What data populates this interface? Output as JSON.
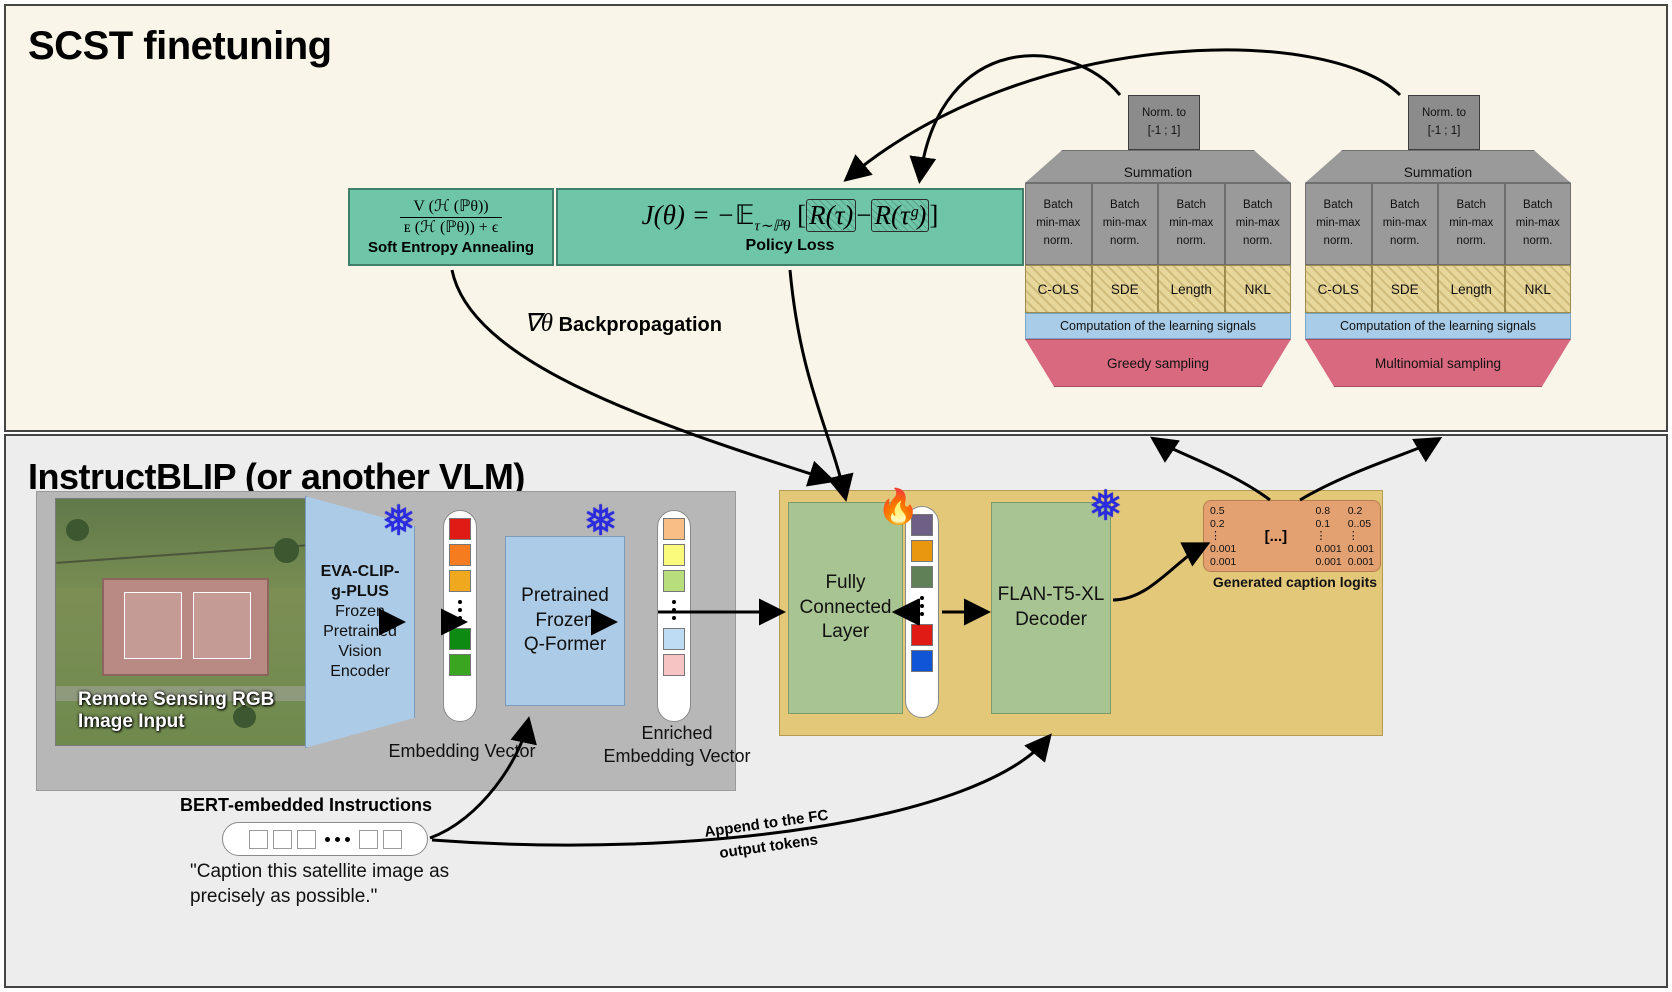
{
  "panels": {
    "scst_title": "SCST finetuning",
    "vlm_title": "InstructBLIP (or another VLM)"
  },
  "formulas": {
    "sea_numerator": "V (ℋ (ℙθ))",
    "sea_denominator": "ᴇ (ℋ (ℙθ)) + ϵ",
    "sea_label": "Soft Entropy Annealing",
    "policy_loss_label": "Policy Loss",
    "policy_eq_lhs": "J(θ) = −",
    "policy_eq_exp": "𝔼",
    "policy_eq_sub": "τ∼ℙθ",
    "policy_eq_bracket_open": "[",
    "policy_eq_term1": "R(τ)",
    "policy_eq_minus": "−",
    "policy_eq_term2": "R(τᵍ)",
    "policy_eq_bracket_close": "]",
    "backprop_label": "Backpropagation",
    "backprop_symbol": "∇θ"
  },
  "reward_columns": [
    {
      "id": "greedy",
      "norm_line1": "Norm. to",
      "norm_line2": "[-1 ; 1]",
      "summation": "Summation",
      "norm_cells": [
        {
          "l1": "Batch",
          "l2": "min-max",
          "l3": "norm."
        },
        {
          "l1": "Batch",
          "l2": "min-max",
          "l3": "norm."
        },
        {
          "l1": "Batch",
          "l2": "min-max",
          "l3": "norm."
        },
        {
          "l1": "Batch",
          "l2": "min-max",
          "l3": "norm."
        }
      ],
      "rewards": [
        "C-OLS",
        "SDE",
        "Length",
        "NKL"
      ],
      "signals": "Computation of the learning signals",
      "sampling": "Greedy sampling"
    },
    {
      "id": "multinomial",
      "norm_line1": "Norm. to",
      "norm_line2": "[-1 ; 1]",
      "summation": "Summation",
      "norm_cells": [
        {
          "l1": "Batch",
          "l2": "min-max",
          "l3": "norm."
        },
        {
          "l1": "Batch",
          "l2": "min-max",
          "l3": "norm."
        },
        {
          "l1": "Batch",
          "l2": "min-max",
          "l3": "norm."
        },
        {
          "l1": "Batch",
          "l2": "min-max",
          "l3": "norm."
        }
      ],
      "rewards": [
        "C-OLS",
        "SDE",
        "Length",
        "NKL"
      ],
      "signals": "Computation of the learning signals",
      "sampling": "Multinomial sampling"
    }
  ],
  "vlm": {
    "image_caption": "Remote Sensing RGB Image Input",
    "vision_encoder": {
      "bold_line1": "EVA-CLIP-",
      "bold_line2": "g-PLUS",
      "line3": "Frozen",
      "line4": "Pretrained",
      "line5": "Vision",
      "line6": "Encoder"
    },
    "qformer": {
      "line1": "Pretrained",
      "line2": "Frozen",
      "line3": "Q-Former"
    },
    "embedding_label": "Embedding Vector",
    "enriched_label": "Enriched Embedding Vector",
    "fc_layer": {
      "line1": "Fully",
      "line2": "Connected",
      "line3": "Layer"
    },
    "decoder": {
      "line1": "FLAN-T5-XL",
      "line2": "Decoder"
    },
    "vectors": {
      "embedding_colors": [
        "#e01b16",
        "#f57d20",
        "#f0a81e",
        "#0c8a12",
        "#3aa520"
      ],
      "enriched_colors": [
        "#f9bd86",
        "#fafa7d",
        "#b7dd7d",
        "#bfdcf5",
        "#f7c4c4"
      ],
      "fc_colors": [
        "#6d5f86",
        "#e8970e",
        "#5e8158",
        "#e01b16",
        "#0f55d6"
      ]
    },
    "icons": {
      "snowflake": "❅",
      "flame": "🔥"
    }
  },
  "logits": {
    "label": "Generated caption logits",
    "col1": [
      "0.5",
      "0.2",
      "⋮",
      "0.001",
      "0.001"
    ],
    "ellipsis": "[...]",
    "col2": [
      "0.8",
      "0.1",
      "⋮",
      "0.001",
      "0.001"
    ],
    "col3": [
      "0.2",
      "0..05",
      "⋮",
      "0.001",
      "0.001"
    ]
  },
  "instructions": {
    "bert_label": "BERT-embedded Instructions",
    "prompt": "\"Caption this satellite image as precisely as possible.\"",
    "append_line1": "Append to the FC",
    "append_line2": "output tokens"
  },
  "colors": {
    "scst_bg": "#faf5e9",
    "vlm_bg": "#ededed",
    "teal": "#6ec5a8",
    "grey_module": "#9a9a9a",
    "reward_yellow": "#e8d79a",
    "signals_blue": "#a9cce8",
    "sampling_pink": "#d9697f",
    "decoder_orange": "#e3c879",
    "logits_orange": "#e3a172",
    "block_blue": "#accbe6",
    "block_green": "#a8c493",
    "snowflake_blue": "#2a2ae0"
  }
}
